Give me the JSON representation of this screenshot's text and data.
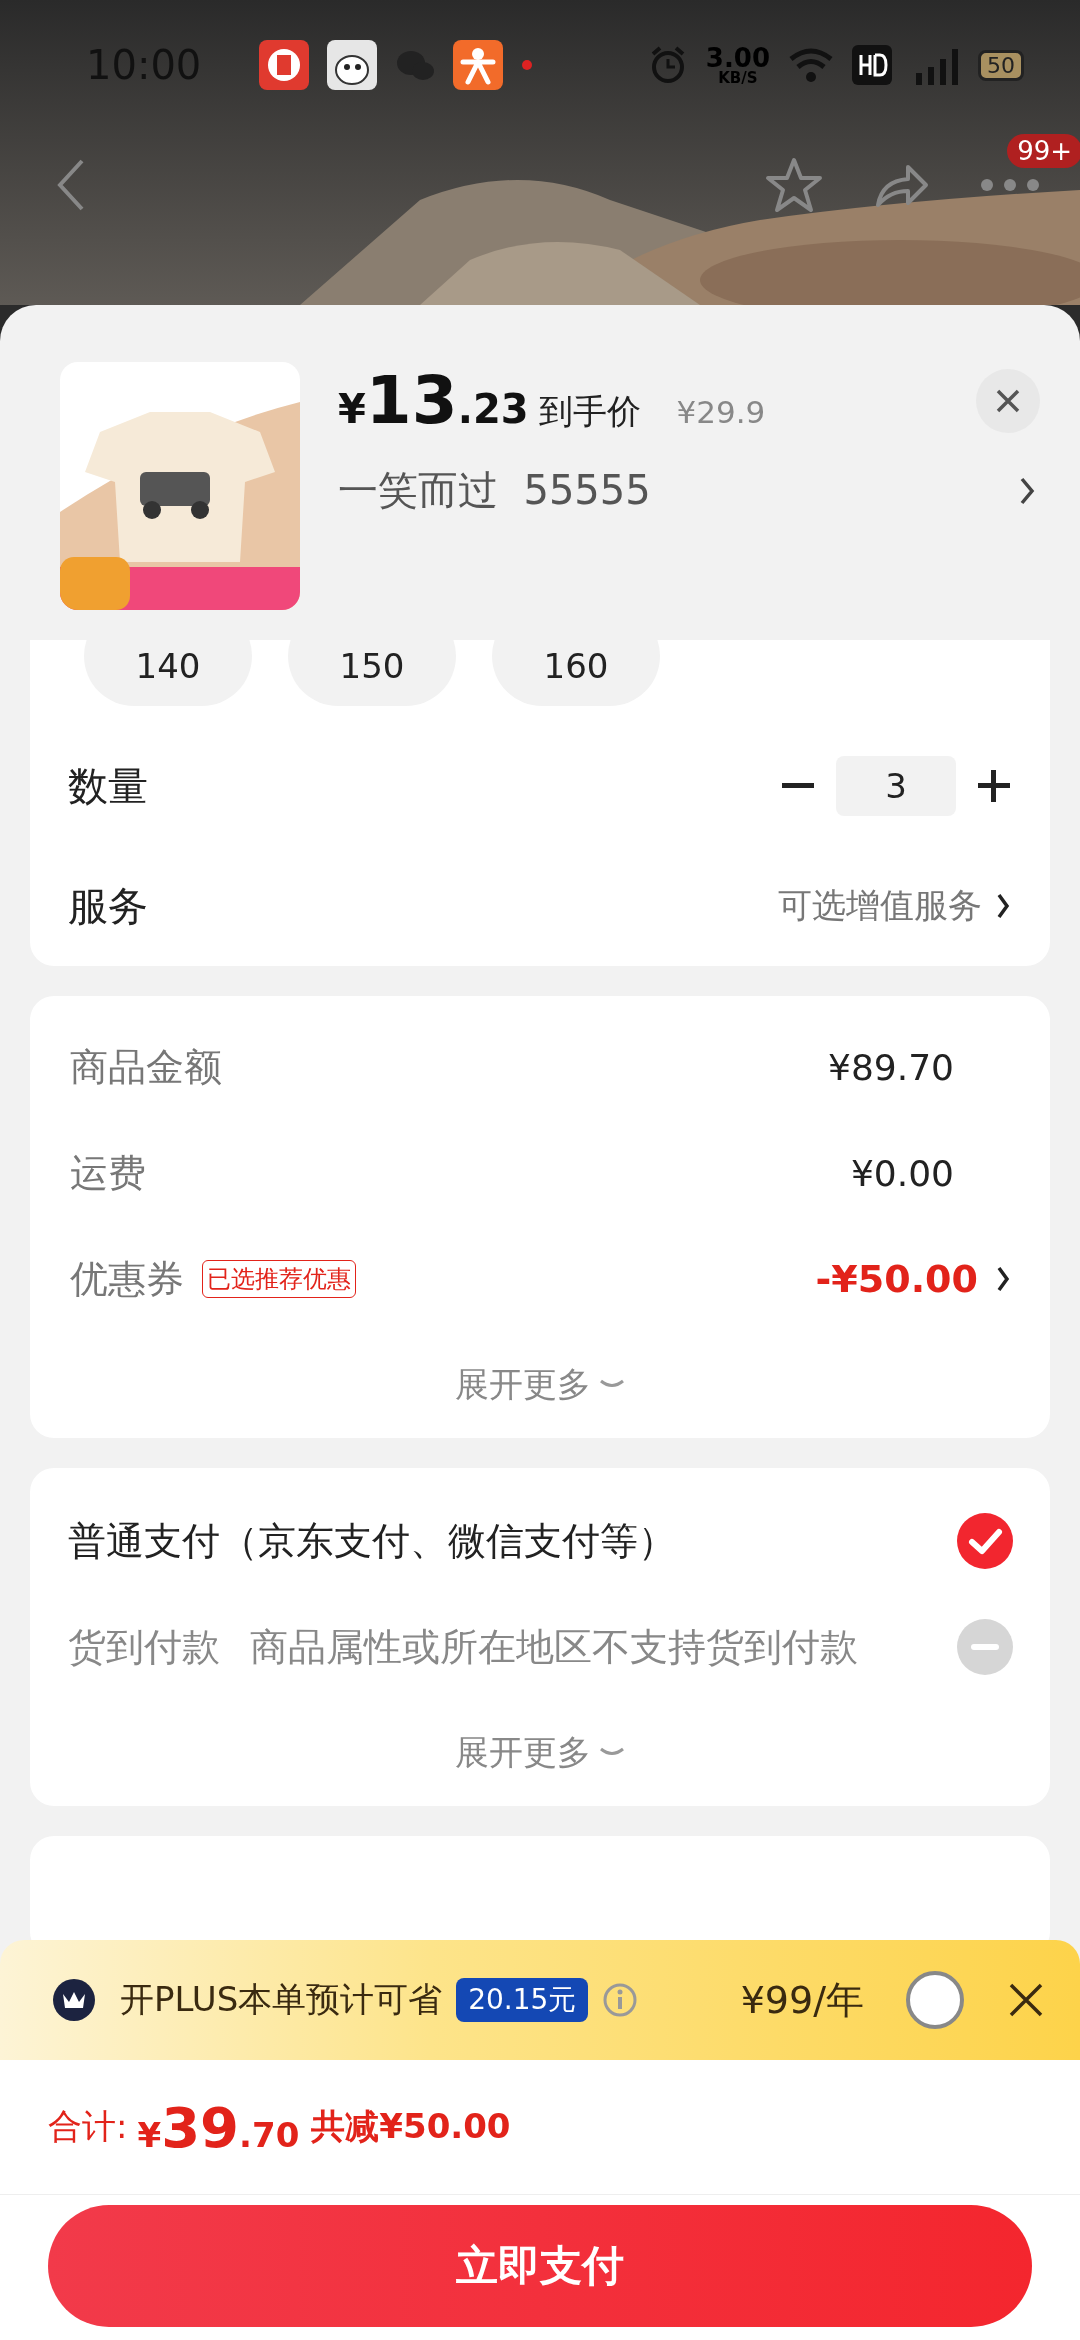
{
  "status_bar": {
    "time": "10:00",
    "network_speed": "3.00",
    "speed_unit": "KB/S",
    "battery": "50"
  },
  "nav": {
    "badge": "99+"
  },
  "product": {
    "currency": "¥",
    "price_int": "13",
    "price_dec": ".23",
    "price_label": "到手价",
    "original_price": "¥29.9",
    "variant": "一笑而过  55555"
  },
  "sizes": [
    {
      "label": "140",
      "selected": false
    },
    {
      "label": "150",
      "selected": false
    },
    {
      "label": "160",
      "selected": false
    }
  ],
  "quantity": {
    "label": "数量",
    "value": "3"
  },
  "service": {
    "label": "服务",
    "value": "可选增值服务"
  },
  "summary": {
    "rows": [
      {
        "kind": "plain",
        "label": "商品金额",
        "value": "¥89.70"
      },
      {
        "kind": "plain",
        "label": "运费",
        "value": "¥0.00"
      },
      {
        "kind": "coupon",
        "label": "优惠券",
        "tag": "已选推荐优惠",
        "value": "-¥50.00"
      }
    ],
    "expand": "展开更多"
  },
  "payment": {
    "options": [
      {
        "label": "普通支付（京东支付、微信支付等）",
        "selected": true,
        "disabled": false
      },
      {
        "label": "货到付款",
        "note": "商品属性或所在地区不支持货到付款",
        "selected": false,
        "disabled": true
      }
    ],
    "expand": "展开更多"
  },
  "plus_banner": {
    "text": "开PLUS本单预计可省",
    "savings": "20.15元",
    "price": "¥99/年",
    "checked": false
  },
  "total": {
    "label": "合计:",
    "currency": "¥",
    "int": "39",
    "dec": ".70",
    "discount": "共减¥50.00"
  },
  "pay_button": "立即支付"
}
